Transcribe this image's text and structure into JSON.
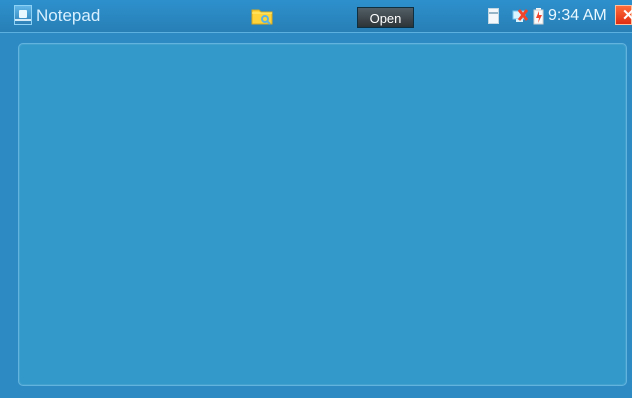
{
  "app": {
    "title": "Notepad",
    "icon": "notepad-icon"
  },
  "toolbar": {
    "folder_icon": "folder-search-icon",
    "open_label": "Open"
  },
  "status": {
    "storage_icon": "storage-card-icon",
    "network_icon": "network-status-icon",
    "battery_icon": "battery-icon",
    "time": "9:34 AM",
    "close_icon": "close-icon"
  },
  "editor": {
    "text": ""
  },
  "colors": {
    "background": "#2e8ac3",
    "editor_background": "#3399ca",
    "close_button": "#e23a18",
    "folder_icon": "#ffd43a"
  }
}
